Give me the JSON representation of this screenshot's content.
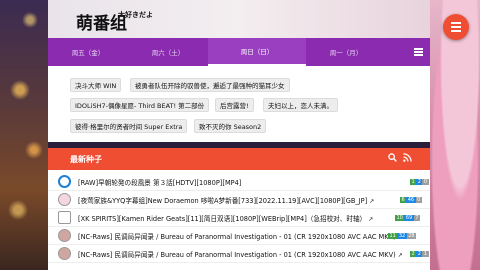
{
  "header": {
    "logo": "萌番组",
    "logo_sub": "大好きだよ"
  },
  "tabs": [
    {
      "label": "周五（金）",
      "active": false
    },
    {
      "label": "周六（土）",
      "active": false
    },
    {
      "label": "周日（日）",
      "active": true
    },
    {
      "label": "周一（月）",
      "active": false
    }
  ],
  "tags": [
    "决斗大师 WIN",
    "被勇者队伍开除的驭兽使，邂逅了最强种的猫耳少女",
    "IDOLiSH7-偶像星愿- Third BEAT! 第二部份",
    "后宫露营!",
    "夫妇以上，恋人未满。",
    "彼得·格里尔的贤者时间 Super Extra",
    "致不灭的你 Season2"
  ],
  "section": {
    "title": "最新种子"
  },
  "torrents": [
    {
      "title": "[RAW]早朝轮発の段風景 第３話[HDTV][1080P][MP4]",
      "stats": [
        "1",
        "2",
        "0"
      ]
    },
    {
      "title": "[夜莺家族&YYQ字幕组]New Doraemon 哆啦A梦新番[733][2022.11.19][AVC][1080P][GB_JP]",
      "stats": [
        "6",
        "46",
        "0"
      ]
    },
    {
      "title": "[XK SPIRITS][Kamen Rider Geats][11][简日双语][1080P][WEBrip][MP4]（急招校对、时轴）",
      "stats": [
        "10",
        "69",
        "7"
      ]
    },
    {
      "title": "[NC-Raws] 民调局异闻录 / Bureau of Paranormal Investigation - 01 (CR 1920x1080 AVC AAC MKV)",
      "stats": [
        "11",
        "32",
        "28"
      ]
    },
    {
      "title": "[NC-Raws] 民调局异闻录 / Bureau of Paranormal Investigation - 01 (CR 1920x1080 AVC AAC MKV)",
      "stats": [
        "2",
        "2",
        "1"
      ]
    }
  ],
  "colors": {
    "accent": "#f04e33",
    "tabbar": "#8b2bb0",
    "stat_green": "#43a047",
    "stat_blue": "#1e88e5",
    "stat_grey": "#9e9e9e"
  }
}
